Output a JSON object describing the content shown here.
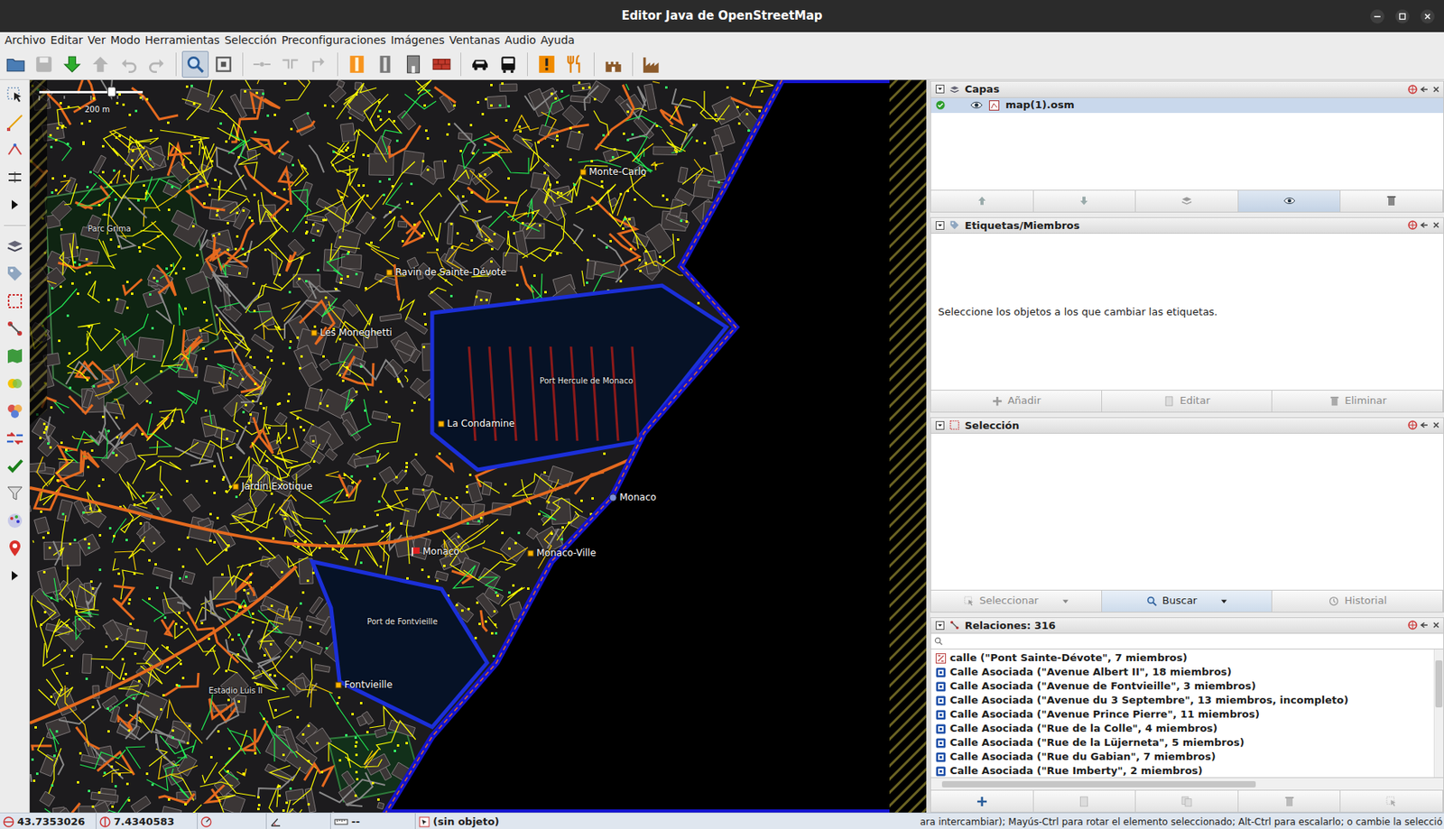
{
  "window": {
    "title": "Editor Java de OpenStreetMap"
  },
  "menu": [
    "Archivo",
    "Editar",
    "Ver",
    "Modo",
    "Herramientas",
    "Selección",
    "Preconfiguraciones",
    "Imágenes",
    "Ventanas",
    "Audio",
    "Ayuda"
  ],
  "toolbar": [
    {
      "disabled": false,
      "pressed": false
    },
    {
      "disabled": true,
      "pressed": false
    },
    {
      "disabled": false,
      "pressed": false
    },
    {
      "disabled": true,
      "pressed": false
    },
    {
      "disabled": true,
      "pressed": false
    },
    {
      "disabled": true,
      "pressed": false
    },
    {
      "disabled": false,
      "pressed": true
    },
    {
      "disabled": false,
      "pressed": false
    },
    {
      "disabled": true,
      "pressed": false
    },
    {
      "disabled": true,
      "pressed": false
    },
    {
      "disabled": true,
      "pressed": false
    },
    {
      "disabled": false,
      "pressed": false
    },
    {
      "disabled": false,
      "pressed": false
    },
    {
      "disabled": false,
      "pressed": false
    },
    {
      "disabled": false,
      "pressed": false
    },
    {
      "disabled": false,
      "pressed": false
    },
    {
      "disabled": false,
      "pressed": false
    },
    {
      "disabled": false,
      "pressed": false
    },
    {
      "disabled": false,
      "pressed": false
    },
    {
      "disabled": false,
      "pressed": false
    },
    {
      "disabled": false,
      "pressed": false
    }
  ],
  "map": {
    "zoom": {
      "level": 0.7
    },
    "scale": "200 m",
    "labels": [
      {
        "text": "Monte-Carlo",
        "kind": "place"
      },
      {
        "text": "Parc Grima",
        "kind": "water"
      },
      {
        "text": "Ravin de Sainte-Dévote",
        "kind": "place"
      },
      {
        "text": "Les Moneghetti",
        "kind": "place"
      },
      {
        "text": "Port Hercule de Monaco",
        "kind": "water"
      },
      {
        "text": "La Condamine",
        "kind": "place"
      },
      {
        "text": "Jardin Exotique",
        "kind": "place"
      },
      {
        "text": "Monaco",
        "kind": "country"
      },
      {
        "text": "Monaco",
        "kind": "capital"
      },
      {
        "text": "Monaco-Ville",
        "kind": "place"
      },
      {
        "text": "Port de Fontvieille",
        "kind": "water"
      },
      {
        "text": "Estadio Luis II",
        "kind": "water"
      },
      {
        "text": "Fontvieille",
        "kind": "place"
      }
    ]
  },
  "layers": {
    "title": "Capas",
    "items": [
      {
        "name": "map(1).osm",
        "active": true,
        "visible": true,
        "selected": true
      }
    ],
    "buttons": [
      {
        "disabled": true,
        "pressed": false
      },
      {
        "disabled": true,
        "pressed": false
      },
      {
        "disabled": true,
        "pressed": false
      },
      {
        "disabled": false,
        "pressed": true
      },
      {
        "disabled": false,
        "pressed": false
      }
    ]
  },
  "tags": {
    "title": "Etiquetas/Miembros",
    "message": "Seleccione los objetos a los que cambiar las etiquetas.",
    "buttons": [
      {
        "label": "Añadir",
        "disabled": true
      },
      {
        "label": "Editar",
        "disabled": true
      },
      {
        "label": "Eliminar",
        "disabled": true
      }
    ]
  },
  "selection": {
    "title": "Selección",
    "buttons": [
      {
        "label": "Seleccionar",
        "disabled": true
      },
      {
        "label": "Buscar",
        "disabled": false
      },
      {
        "label": "Historial",
        "disabled": true
      }
    ]
  },
  "relations": {
    "title": "Relaciones: 316",
    "items": [
      {
        "text": "calle (\"Pont Sainte-Dévote\", 7 miembros)",
        "kind": "street"
      },
      {
        "text": "Calle Asociada (\"Avenue Albert II\", 18 miembros)",
        "kind": "associated"
      },
      {
        "text": "Calle Asociada (\"Avenue de Fontvieille\", 3 miembros)",
        "kind": "associated"
      },
      {
        "text": "Calle Asociada (\"Avenue du 3 Septembre\", 13 miembros, incompleto)",
        "kind": "associated"
      },
      {
        "text": "Calle Asociada (\"Avenue Prince Pierre\", 11 miembros)",
        "kind": "associated"
      },
      {
        "text": "Calle Asociada (\"Rue de la Colle\", 4 miembros)",
        "kind": "associated"
      },
      {
        "text": "Calle Asociada (\"Rue de la Lüjerneta\", 5 miembros)",
        "kind": "associated"
      },
      {
        "text": "Calle Asociada (\"Rue du Gabian\", 7 miembros)",
        "kind": "associated"
      },
      {
        "text": "Calle Asociada (\"Rue Imberty\", 2 miembros)",
        "kind": "associated"
      }
    ],
    "buttons": [
      {
        "disabled": false
      },
      {
        "disabled": true
      },
      {
        "disabled": true
      },
      {
        "disabled": true
      },
      {
        "disabled": true
      }
    ]
  },
  "status_bar": {
    "lat": "43.7353026",
    "lon": "7.4340583",
    "distance": "--",
    "object": "(sin objeto)",
    "help": "ara intercambiar); Mayús-Ctrl para rotar el elemento seleccionado; Alt-Ctrl para escalarlo; o cambie la selecció"
  }
}
